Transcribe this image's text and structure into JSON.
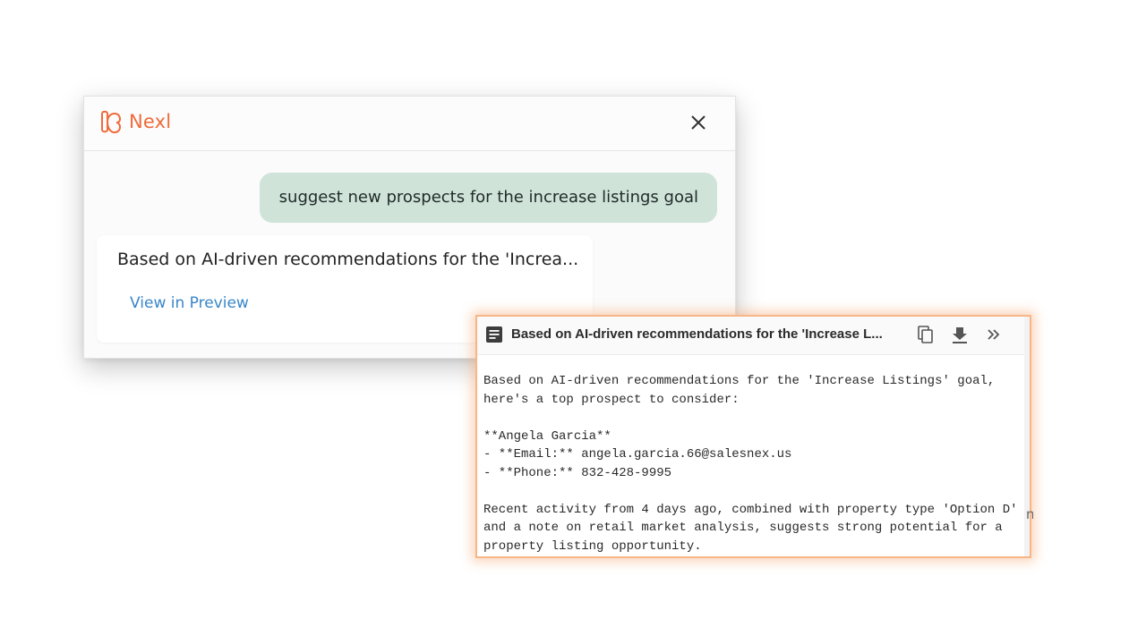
{
  "chat": {
    "brand": {
      "name": "Nexl",
      "color": "#f06a3a"
    },
    "user_message": "suggest new prospects for the increase listings goal",
    "bot_message": "Based on AI-driven recommendations for the 'Increa...",
    "preview_link": "View in Preview",
    "bubble_color": "#cfe3d9",
    "link_color": "#3a86c8"
  },
  "preview": {
    "title": "Based on AI-driven recommendations for the 'Increase L...",
    "icons": [
      "document-icon",
      "copy-icon",
      "download-icon",
      "expand-icon"
    ],
    "accent_border": "#f7b588",
    "lines": [
      "Based on AI-driven recommendations for the 'Increase Listings' goal,",
      "here's a top prospect to consider:",
      "",
      "**Angela Garcia**",
      "- **Email:** angela.garcia.66@salesnex.us",
      "- **Phone:** 832-428-9995",
      "",
      "Recent activity from 4 days ago, combined with property type 'Option D'",
      "and a note on retail market analysis, suggests strong potential for a",
      "property listing opportunity."
    ]
  },
  "background_edge_text": "na"
}
